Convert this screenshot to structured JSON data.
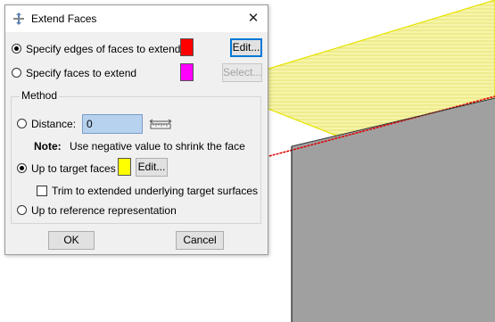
{
  "dialog": {
    "title": "Extend Faces",
    "close_symbol": "✕",
    "specify_edges_label": "Specify edges of faces to extend",
    "specify_edges_selected": true,
    "edges_color": "#ff0000",
    "edges_edit_label": "Edit...",
    "specify_faces_label": "Specify faces to extend",
    "specify_faces_selected": false,
    "faces_color": "#ff00ff",
    "faces_select_label": "Select...",
    "method": {
      "group_label": "Method",
      "distance_label": "Distance:",
      "distance_selected": false,
      "distance_value": "0",
      "note_label": "Note:",
      "note_text": "Use negative value to shrink the face",
      "target_faces_label": "Up to target faces",
      "target_faces_selected": true,
      "target_color": "#ffff00",
      "target_edit_label": "Edit...",
      "trim_label": "Trim to extended underlying target surfaces",
      "trim_checked": false,
      "reference_label": "Up to reference representation",
      "reference_selected": false
    },
    "ok_label": "OK",
    "cancel_label": "Cancel"
  },
  "viewport": {
    "top_face_color": "#f6f5a8",
    "side_face_color": "#a0a0a0",
    "selected_edge_color": "#ff0000"
  }
}
